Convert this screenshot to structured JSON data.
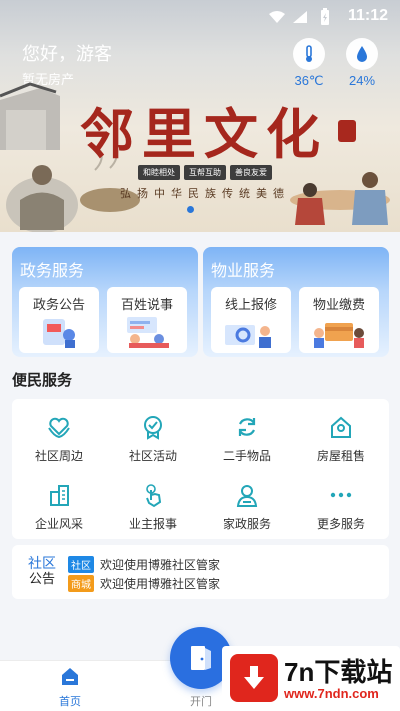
{
  "status_bar": {
    "time": "11:12"
  },
  "banner": {
    "greeting": "您好，游客",
    "no_house": "暂无房产",
    "temperature": "36℃",
    "humidity": "24%",
    "title": "邻里文化",
    "tags": [
      "和睦相处",
      "互帮互助",
      "善良友爱"
    ],
    "slogan": "弘扬中华民族传统美德"
  },
  "gov_service": {
    "title": "政务服务",
    "items": [
      {
        "label": "政务公告"
      },
      {
        "label": "百姓说事"
      }
    ]
  },
  "property_service": {
    "title": "物业服务",
    "items": [
      {
        "label": "线上报修"
      },
      {
        "label": "物业缴费"
      }
    ]
  },
  "convenience": {
    "title": "便民服务",
    "items": [
      {
        "label": "社区周边",
        "icon": "heart-hands-icon"
      },
      {
        "label": "社区活动",
        "icon": "medal-icon"
      },
      {
        "label": "二手物品",
        "icon": "recycle-icon"
      },
      {
        "label": "房屋租售",
        "icon": "house-icon"
      },
      {
        "label": "企业风采",
        "icon": "building-icon"
      },
      {
        "label": "业主报事",
        "icon": "tap-hand-icon"
      },
      {
        "label": "家政服务",
        "icon": "housekeeper-icon"
      },
      {
        "label": "更多服务",
        "icon": "more-dots-icon"
      }
    ]
  },
  "notice": {
    "logo_top": "社区",
    "logo_bottom": "公告",
    "rows": [
      {
        "badge": "社区",
        "text": "欢迎使用博雅社区管家"
      },
      {
        "badge": "商城",
        "text": "欢迎使用博雅社区管家"
      }
    ]
  },
  "tabbar": {
    "home": "首页",
    "open_door": "开门"
  },
  "watermark": {
    "title": "7n下载站",
    "url": "www.7ndn.com"
  },
  "colors": {
    "primary": "#2a77d9",
    "accent_red": "#a5271d",
    "badge_blue": "#1e88e5",
    "badge_orange": "#f39b1b"
  }
}
